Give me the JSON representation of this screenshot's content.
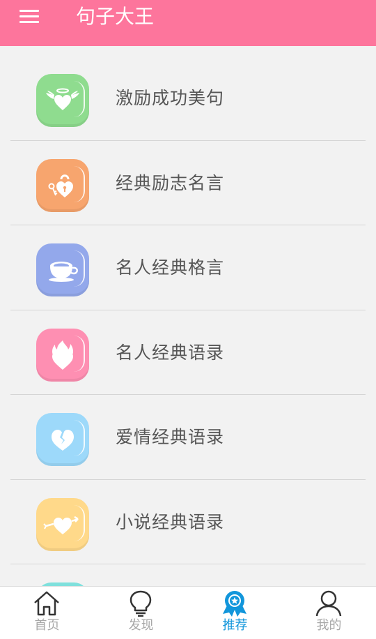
{
  "header": {
    "title": "句子大王",
    "bg_color": "#fd759c"
  },
  "list": {
    "items": [
      {
        "label": "激励成功美句",
        "icon": "winged-heart-icon",
        "color": "#8fdc8f"
      },
      {
        "label": "经典励志名言",
        "icon": "heart-lock-key-icon",
        "color": "#f7a56e"
      },
      {
        "label": "名人经典格言",
        "icon": "teacup-icon",
        "color": "#93a8eb"
      },
      {
        "label": "名人经典语录",
        "icon": "flaming-heart-icon",
        "color": "#fe8fb2"
      },
      {
        "label": "爱情经典语录",
        "icon": "broken-heart-icon",
        "color": "#9dd9fa"
      },
      {
        "label": "小说经典语录",
        "icon": "arrow-heart-icon",
        "color": "#ffd98a"
      }
    ],
    "partial_next_color": "#7fe0dc"
  },
  "tabbar": {
    "tabs": [
      {
        "label": "首页",
        "icon": "home-icon"
      },
      {
        "label": "发现",
        "icon": "lightbulb-icon"
      },
      {
        "label": "推荐",
        "icon": "award-badge-icon",
        "active": true
      },
      {
        "label": "我的",
        "icon": "user-icon"
      }
    ],
    "active_color": "#1296db",
    "inactive_color": "#a7a7a7"
  }
}
